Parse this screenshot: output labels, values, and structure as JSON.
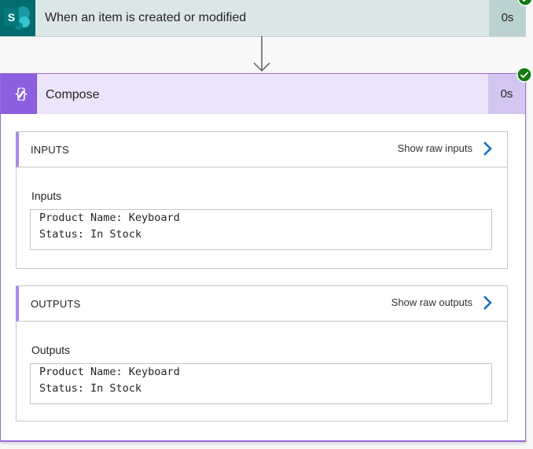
{
  "trigger": {
    "title": "When an item is created or modified",
    "duration": "0s",
    "icon": "sharepoint-icon",
    "status": "succeeded"
  },
  "compose": {
    "title": "Compose",
    "duration": "0s",
    "icon": "compose-icon",
    "status": "succeeded",
    "inputs": {
      "section_label": "INPUTS",
      "raw_link": "Show raw inputs",
      "field_label": "Inputs",
      "lines": [
        "Product Name: Keyboard",
        "Status: In Stock"
      ]
    },
    "outputs": {
      "section_label": "OUTPUTS",
      "raw_link": "Show raw outputs",
      "field_label": "Outputs",
      "lines": [
        "Product Name: Keyboard",
        "Status: In Stock"
      ]
    }
  },
  "colors": {
    "sharepoint": "#036c70",
    "compose": "#8c5fe0",
    "success": "#107c10",
    "link_chevron": "#0f6cbd"
  }
}
